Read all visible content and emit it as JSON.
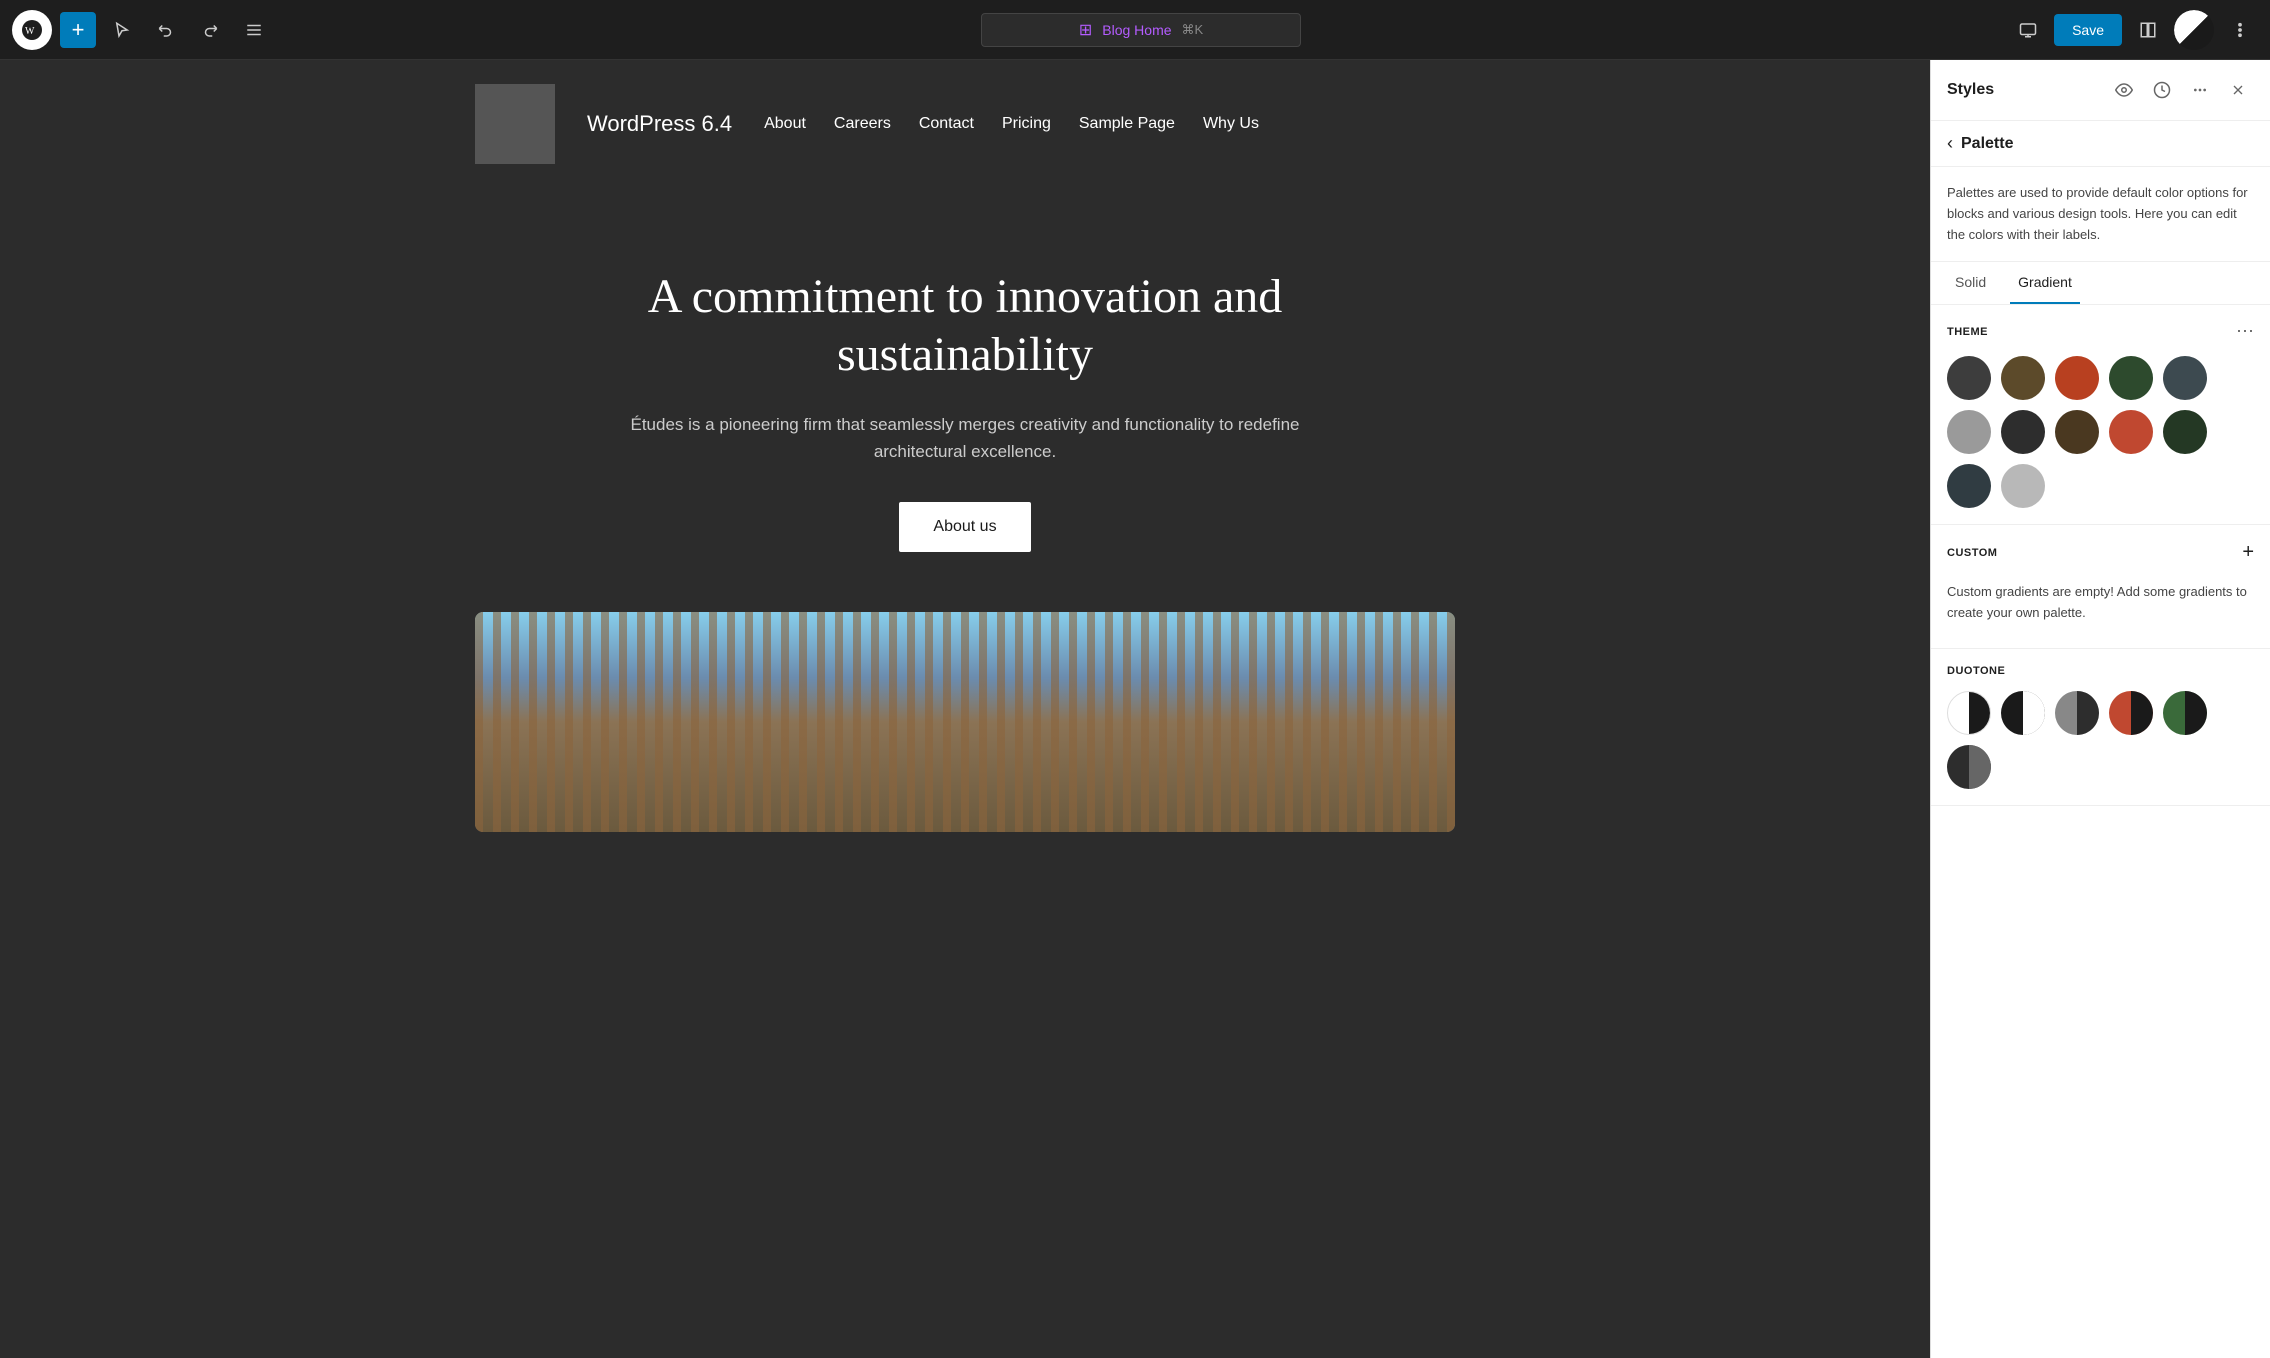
{
  "toolbar": {
    "add_label": "+",
    "page_title": "Blog Home",
    "page_title_icon": "⊞",
    "shortcut": "⌘K",
    "save_label": "Save"
  },
  "site": {
    "title": "WordPress 6.4",
    "nav_items": [
      "About",
      "Careers",
      "Contact",
      "Pricing",
      "Sample Page",
      "Why Us"
    ]
  },
  "hero": {
    "title": "A commitment to innovation and sustainability",
    "subtitle": "Études is a pioneering firm that seamlessly merges creativity and functionality to redefine architectural excellence.",
    "cta_label": "About us"
  },
  "styles_panel": {
    "title": "Styles",
    "breadcrumb": "Palette",
    "description": "Palettes are used to provide default color options for blocks and various design tools. Here you can edit the colors with their labels.",
    "tab_solid": "Solid",
    "tab_gradient": "Gradient",
    "theme_section_title": "THEME",
    "custom_section_title": "CUSTOM",
    "duotone_section_title": "DUOTONE",
    "custom_empty_text": "Custom gradients are empty! Add some gradients to create your own palette.",
    "theme_colors": [
      {
        "bg": "#3d3d3d",
        "row": 0
      },
      {
        "bg": "#5c4a2a",
        "row": 0
      },
      {
        "bg": "#b84020",
        "row": 0
      },
      {
        "bg": "#2d4a2d",
        "row": 0
      },
      {
        "bg": "#3d4a50",
        "row": 0
      },
      {
        "bg": "#9a9a9a",
        "row": 0
      },
      {
        "bg": "#2d2d2d",
        "row": 1
      },
      {
        "bg": "#4a3820",
        "row": 1
      },
      {
        "bg": "#c04830",
        "row": 1
      },
      {
        "bg": "#243824",
        "row": 1
      },
      {
        "bg": "#303c42",
        "row": 1
      },
      {
        "bg": "#b8b8b8",
        "row": 1
      }
    ],
    "duotone_swatches": [
      {
        "type": "white-black"
      },
      {
        "type": "black-white"
      },
      {
        "type": "gray-dark"
      },
      {
        "type": "red-dark"
      },
      {
        "type": "green-dark"
      },
      {
        "type": "dark-gray"
      }
    ]
  }
}
